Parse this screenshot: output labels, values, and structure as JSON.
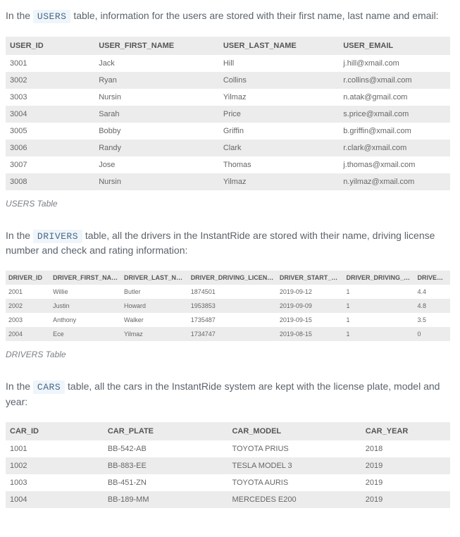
{
  "users": {
    "intro_before": "In the ",
    "code": "USERS",
    "intro_after": " table, information for the users are stored with their first name, last name and email:",
    "headers": [
      "USER_ID",
      "USER_FIRST_NAME",
      "USER_LAST_NAME",
      "USER_EMAIL"
    ],
    "rows": [
      [
        "3001",
        "Jack",
        "Hill",
        "j.hill@xmail.com"
      ],
      [
        "3002",
        "Ryan",
        "Collins",
        "r.collins@xmail.com"
      ],
      [
        "3003",
        "Nursin",
        "Yilmaz",
        "n.atak@gmail.com"
      ],
      [
        "3004",
        "Sarah",
        "Price",
        "s.price@xmail.com"
      ],
      [
        "3005",
        "Bobby",
        "Griffin",
        "b.griffin@xmail.com"
      ],
      [
        "3006",
        "Randy",
        "Clark",
        "r.clark@xmail.com"
      ],
      [
        "3007",
        "Jose",
        "Thomas",
        "j.thomas@xmail.com"
      ],
      [
        "3008",
        "Nursin",
        "Yilmaz",
        "n.yilmaz@xmail.com"
      ]
    ],
    "caption": "USERS Table"
  },
  "drivers": {
    "intro_before": "In the ",
    "code": "DRIVERS",
    "intro_after": " table, all the drivers in the InstantRide are stored with their name, driving license number and check and rating information:",
    "headers": [
      "DRIVER_ID",
      "DRIVER_FIRST_NAME",
      "DRIVER_LAST_NAME",
      "DRIVER_DRIVING_LICENSE_ID",
      "DRIVER_START_DATE",
      "DRIVER_DRIVING_LICENSE_CHECKED",
      "DRIVER_RATING"
    ],
    "rows": [
      [
        "2001",
        "Willie",
        "Butler",
        "1874501",
        "2019-09-12",
        "1",
        "4.4"
      ],
      [
        "2002",
        "Justin",
        "Howard",
        "1953853",
        "2019-09-09",
        "1",
        "4.8"
      ],
      [
        "2003",
        "Anthony",
        "Walker",
        "1735487",
        "2019-09-15",
        "1",
        "3.5"
      ],
      [
        "2004",
        "Ece",
        "Yilmaz",
        "1734747",
        "2019-08-15",
        "1",
        "0"
      ]
    ],
    "caption": "DRIVERS Table"
  },
  "cars": {
    "intro_before": "In the ",
    "code": "CARS",
    "intro_after": " table, all the cars in the InstantRide system are kept with the license plate, model and year:",
    "headers": [
      "CAR_ID",
      "CAR_PLATE",
      "CAR_MODEL",
      "CAR_YEAR"
    ],
    "rows": [
      [
        "1001",
        "BB-542-AB",
        "TOYOTA PRIUS",
        "2018"
      ],
      [
        "1002",
        "BB-883-EE",
        "TESLA MODEL 3",
        "2019"
      ],
      [
        "1003",
        "BB-451-ZN",
        "TOYOTA AURIS",
        "2019"
      ],
      [
        "1004",
        "BB-189-MM",
        "MERCEDES E200",
        "2019"
      ]
    ],
    "caption": ""
  }
}
